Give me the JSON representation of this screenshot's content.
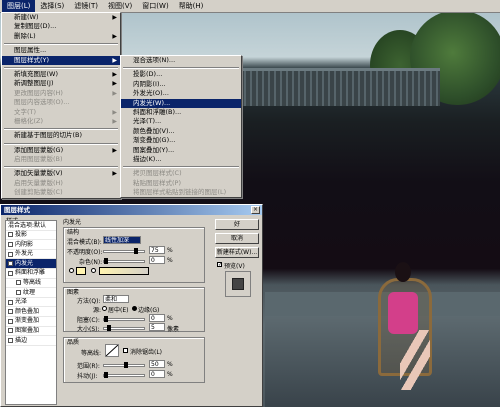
{
  "menubar": {
    "items": [
      "图层(L)",
      "选择(S)",
      "滤镜(T)",
      "视图(V)",
      "窗口(W)",
      "帮助(H)"
    ]
  },
  "layer_menu": {
    "items": [
      {
        "label": "新建(W)",
        "arrow": true
      },
      {
        "label": "复制图层(D)..."
      },
      {
        "label": "删除(L)",
        "arrow": true
      },
      {
        "sep": true
      },
      {
        "label": "图层属性..."
      },
      {
        "label": "图层样式(Y)",
        "arrow": true,
        "hl": true
      },
      {
        "sep": true
      },
      {
        "label": "新填充图层(W)",
        "arrow": true
      },
      {
        "label": "新调整图层(J)",
        "arrow": true
      },
      {
        "label": "更改图层内容(H)",
        "arrow": true,
        "dis": true
      },
      {
        "label": "图层内容选项(O)...",
        "dis": true
      },
      {
        "label": "文字(T)",
        "arrow": true,
        "dis": true
      },
      {
        "label": "栅格化(Z)",
        "arrow": true,
        "dis": true
      },
      {
        "sep": true
      },
      {
        "label": "新建基于图层的切片(B)"
      },
      {
        "sep": true
      },
      {
        "label": "添加图层蒙版(G)",
        "arrow": true
      },
      {
        "label": "启用图层蒙版(B)",
        "dis": true
      },
      {
        "sep": true
      },
      {
        "label": "添加矢量蒙版(V)",
        "arrow": true
      },
      {
        "label": "启用矢量蒙版(H)",
        "dis": true
      },
      {
        "label": "创建剪贴蒙版(C)",
        "dis": true
      }
    ]
  },
  "style_menu": {
    "items": [
      {
        "label": "混合选项(N)..."
      },
      {
        "sep": true
      },
      {
        "label": "投影(D)..."
      },
      {
        "label": "内阴影(I)..."
      },
      {
        "label": "外发光(O)..."
      },
      {
        "label": "内发光(W)...",
        "hl": true
      },
      {
        "label": "斜面和浮雕(B)..."
      },
      {
        "label": "光泽(T)..."
      },
      {
        "label": "颜色叠加(V)..."
      },
      {
        "label": "渐变叠加(G)..."
      },
      {
        "label": "图案叠加(Y)..."
      },
      {
        "label": "描边(K)..."
      },
      {
        "sep": true
      },
      {
        "label": "拷贝图层样式(C)",
        "dis": true
      },
      {
        "label": "粘贴图层样式(P)",
        "dis": true
      },
      {
        "label": "将图层样式粘贴到链接的图层(L)",
        "dis": true
      }
    ]
  },
  "dialog": {
    "title": "图层样式",
    "close": "×",
    "styles_header": "样式",
    "style_list": [
      {
        "label": "混合选项:默认",
        "cb": false
      },
      {
        "label": "投影",
        "cb": true
      },
      {
        "label": "内阴影",
        "cb": true
      },
      {
        "label": "外发光",
        "cb": true
      },
      {
        "label": "内发光",
        "cb": true,
        "hl": true
      },
      {
        "label": "斜面和浮雕",
        "cb": true
      },
      {
        "label": "等高线",
        "cb": true,
        "sub": true
      },
      {
        "label": "纹理",
        "cb": true,
        "sub": true
      },
      {
        "label": "光泽",
        "cb": true
      },
      {
        "label": "颜色叠加",
        "cb": true
      },
      {
        "label": "渐变叠加",
        "cb": true
      },
      {
        "label": "图案叠加",
        "cb": true
      },
      {
        "label": "描边",
        "cb": true
      }
    ],
    "section_title": "内发光",
    "struct": {
      "title": "结构",
      "blend_label": "混合模式(B):",
      "blend_value": "线性加深",
      "opacity_label": "不透明度(O):",
      "opacity_value": "75",
      "noise_label": "杂色(N):",
      "noise_value": "0",
      "pct": "%"
    },
    "elements": {
      "title": "图素",
      "method_label": "方法(Q):",
      "method_value": "柔和",
      "source_label": "源:",
      "source_center": "居中(E)",
      "source_edge": "边缘(G)",
      "choke_label": "阻塞(C):",
      "choke_value": "0",
      "size_label": "大小(S):",
      "size_value": "5",
      "px": "像素",
      "pct": "%"
    },
    "quality": {
      "title": "品质",
      "contour_label": "等高线:",
      "antialias_label": "消除锯齿(L)",
      "range_label": "范围(R):",
      "range_value": "50",
      "jitter_label": "抖动(J):",
      "jitter_value": "0",
      "pct": "%"
    },
    "buttons": {
      "ok": "好",
      "cancel": "取消",
      "new_style": "新建样式(W)...",
      "preview": "预览(V)"
    }
  }
}
